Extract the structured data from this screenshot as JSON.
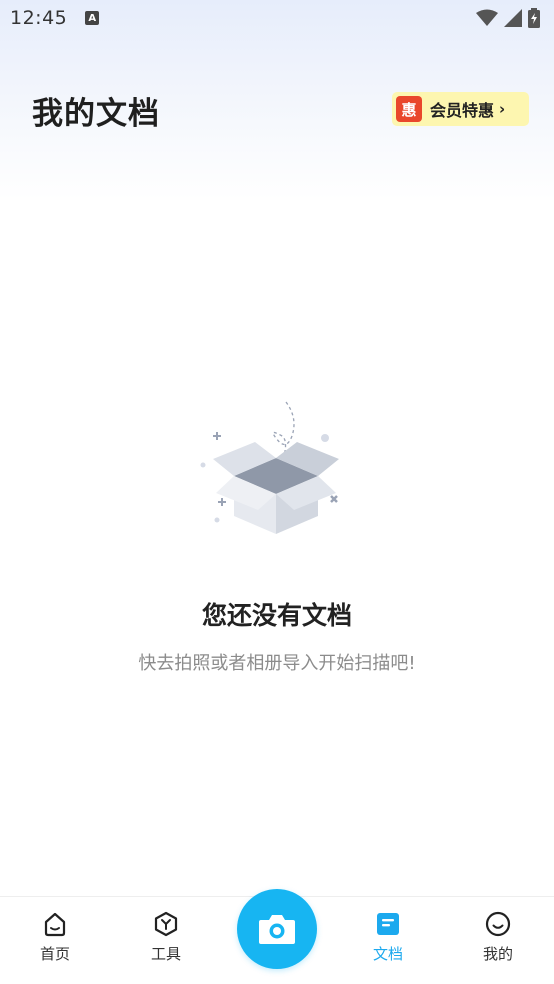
{
  "status_bar": {
    "time": "12:45",
    "notification_icon": "a-icon",
    "icons": [
      "wifi-icon",
      "signal-icon",
      "battery-icon"
    ]
  },
  "header": {
    "title": "我的文档",
    "vip": {
      "icon_text": "惠",
      "label": "会员特惠",
      "chevron": "›"
    }
  },
  "empty_state": {
    "illustration": "empty-box-icon",
    "title": "您还没有文档",
    "subtitle": "快去拍照或者相册导入开始扫描吧!"
  },
  "bottom_nav": {
    "items": [
      {
        "label": "首页",
        "icon": "home-icon",
        "active": false
      },
      {
        "label": "工具",
        "icon": "tools-icon",
        "active": false
      },
      {
        "label": "文档",
        "icon": "document-icon",
        "active": true
      },
      {
        "label": "我的",
        "icon": "profile-icon",
        "active": false
      }
    ],
    "camera": {
      "icon": "camera-icon"
    }
  },
  "colors": {
    "accent": "#17b5f2",
    "active_tab": "#1ca9ee",
    "vip_background": "#fdf6b0",
    "vip_icon": "#e9472b"
  }
}
